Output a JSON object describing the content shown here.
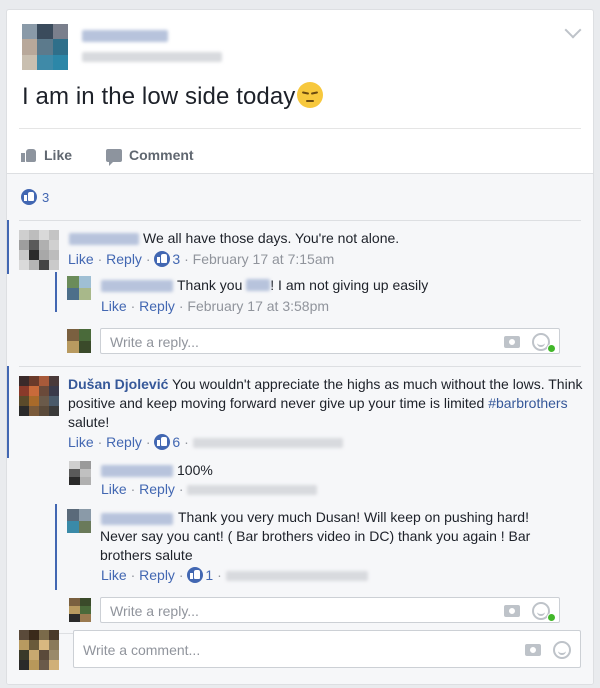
{
  "post": {
    "text": "I am in the low side today",
    "emoji": "pensive-face"
  },
  "actions": {
    "like_label": "Like",
    "comment_label": "Comment"
  },
  "reactions": {
    "count": "3"
  },
  "comments": [
    {
      "text": "We all have those days. You're not alone.",
      "like": "Like",
      "reply": "Reply",
      "likes": "3",
      "time": "February 17 at 7:15am",
      "replies": [
        {
          "text_before": "Thank you ",
          "text_after": "! I am not giving up easily",
          "like": "Like",
          "reply": "Reply",
          "time": "February 17 at 3:58pm"
        }
      ],
      "reply_placeholder": "Write a reply..."
    },
    {
      "author": "Dušan Djolević",
      "text": " You wouldn't appreciate the highs as much without the lows. Think positive and keep moving forward never give up your time is limited ",
      "hashtag": "#barbrothers",
      "text_end": " salute!",
      "like": "Like",
      "reply": "Reply",
      "likes": "6",
      "replies": [
        {
          "text": "100%",
          "like": "Like",
          "reply": "Reply"
        },
        {
          "text": "Thank you very much Dusan! Will keep on pushing hard! Never say you cant! ( Bar brothers video in DC) thank you again ! Bar brothers salute",
          "like": "Like",
          "reply": "Reply",
          "likes": "1"
        }
      ],
      "reply_placeholder": "Write a reply..."
    }
  ],
  "write_comment": {
    "placeholder": "Write a comment..."
  },
  "colors": {
    "accent": "#4267b2",
    "link": "#365899",
    "meta": "#90949c",
    "online": "#42b72a"
  }
}
